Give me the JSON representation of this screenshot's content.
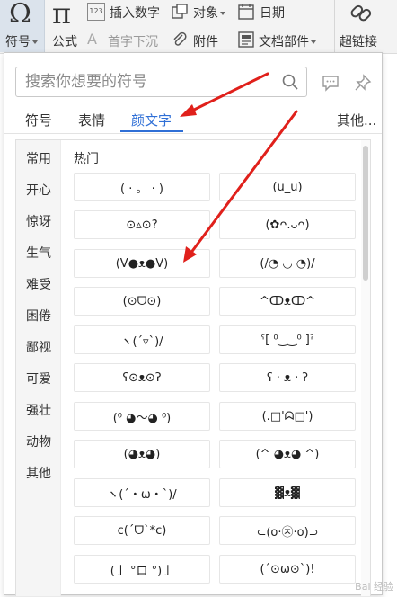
{
  "ribbon": {
    "symbol_label": "符号",
    "formula_label": "公式",
    "insert_number_label": "插入数字",
    "object_label": "对象",
    "date_label": "日期",
    "drop_cap_label": "首字下沉",
    "attachment_label": "附件",
    "doc_parts_label": "文档部件",
    "hyperlink_label": "超链接",
    "insert_number_badge": "123"
  },
  "panel": {
    "search": {
      "placeholder": "搜索你想要的符号"
    },
    "tabs": [
      {
        "label": "符号"
      },
      {
        "label": "表情"
      },
      {
        "label": "颜文字",
        "active": true
      },
      {
        "label": "其他..."
      }
    ],
    "categories": [
      "常用",
      "开心",
      "惊讶",
      "生气",
      "难受",
      "困倦",
      "鄙视",
      "可爱",
      "强壮",
      "动物",
      "其他"
    ],
    "grid_header": "热门",
    "emoticons": [
      "( · 。 · )",
      "(u_u)",
      "⊙▵⊙?",
      "(✿ᴖ.ᴗᴖ)",
      "(V●ᴥ●V)",
      "(/◔ ◡ ◔)/",
      "(⊙ᗜ⊙)",
      "^ↀᴥↀ^",
      "ヽ(ˊ▿ˋ)/",
      "ˁ[ ⁰‿‿⁰ ]ˀ",
      "ʕ⊙ᴥ⊙ʔ",
      "ʕ · ᴥ · ʔ",
      "(⁰ ◕〜◕ ⁰)",
      "(.□'ᗣ□')",
      "(◕ᴥ◕)",
      "(^ ◕ᴥ◕ ^)",
      "ヽ(´・ω・`)/",
      "▓ᴥ▓",
      "c(´ᗜ`*c)",
      "⊂(o·㉨·o)⊃",
      "(亅 °ロ °)亅",
      "(´⊙ω⊙`)!"
    ]
  },
  "colors": {
    "accent": "#2f6fd6",
    "annotation_arrow": "#e0201b"
  },
  "watermark": "Bai 经验"
}
